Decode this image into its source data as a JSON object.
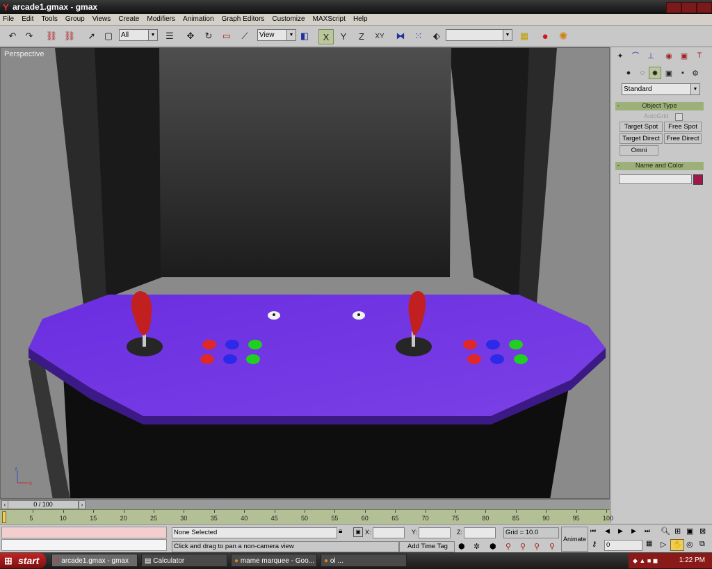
{
  "window": {
    "title": "arcade1.gmax - gmax"
  },
  "menu": [
    "File",
    "Edit",
    "Tools",
    "Group",
    "Views",
    "Create",
    "Modifiers",
    "Animation",
    "Graph Editors",
    "Customize",
    "MAXScript",
    "Help"
  ],
  "toolbar": {
    "selection_filter": "All",
    "ref_coord": "View",
    "axis_x": "X",
    "axis_y": "Y",
    "axis_z": "Z",
    "axis_xy": "XY",
    "named_selection": ""
  },
  "viewport": {
    "label": "Perspective"
  },
  "command_panel": {
    "dropdown_value": "Standard",
    "object_type": {
      "title": "Object Type",
      "autogrid": "AutoGrid",
      "buttons": [
        "Target Spot",
        "Free Spot",
        "Target Direct",
        "Free Direct",
        "Omni"
      ]
    },
    "name_color": {
      "title": "Name and Color",
      "name_value": "",
      "color": "#a0174a"
    },
    "rollout_minus": "-"
  },
  "timeline": {
    "frame_display": "0 / 100",
    "ticks": [
      "5",
      "10",
      "15",
      "20",
      "25",
      "30",
      "35",
      "40",
      "45",
      "50",
      "55",
      "60",
      "65",
      "70",
      "75",
      "80",
      "85",
      "90",
      "95",
      "100"
    ]
  },
  "status": {
    "selection": "None Selected",
    "prompt": "Click and drag to pan a non-camera view",
    "x_label": "X:",
    "y_label": "Y:",
    "z_label": "Z:",
    "x": "",
    "y": "",
    "z": "",
    "grid": "Grid = 10.0",
    "add_time_tag": "Add Time Tag",
    "animate": "Animate",
    "current_frame": "0"
  },
  "taskbar": {
    "start": "start",
    "tasks": [
      "arcade1.gmax - gmax",
      "Calculator",
      "mame marquee - Goo...",
      "ol ..."
    ],
    "clock": "1:22 PM"
  },
  "colors": {
    "panel": "#7a38d8",
    "joystick": "#c22020",
    "btn_red": "#e02828",
    "btn_blue": "#2a2ae8",
    "btn_green": "#20d020"
  }
}
